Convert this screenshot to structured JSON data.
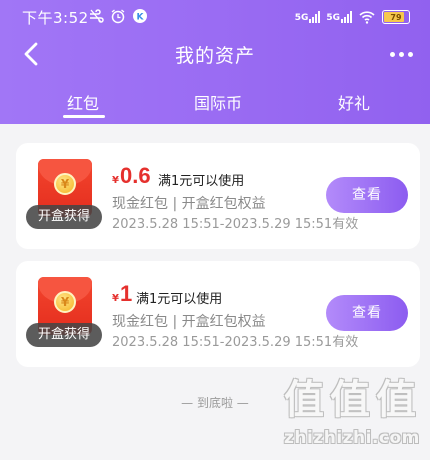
{
  "status_bar": {
    "time": "下午3:52",
    "battery": "79",
    "signal_label": "5G"
  },
  "nav": {
    "title": "我的资产"
  },
  "tabs": [
    {
      "label": "红包",
      "active": true
    },
    {
      "label": "国际币",
      "active": false
    },
    {
      "label": "好礼",
      "active": false
    }
  ],
  "cards": [
    {
      "badge": "开盒获得",
      "coin_symbol": "¥",
      "currency": "¥",
      "amount": "0.6",
      "condition": "满1元可以使用",
      "type_line": "现金红包 | 开盒红包权益",
      "validity": "2023.5.28 15:51-2023.5.29 15:51有效",
      "button": "查看"
    },
    {
      "badge": "开盒获得",
      "coin_symbol": "¥",
      "currency": "¥",
      "amount": "1",
      "condition": "满1元可以使用",
      "type_line": "现金红包 | 开盒红包权益",
      "validity": "2023.5.28 15:51-2023.5.29 15:51有效",
      "button": "查看"
    }
  ],
  "footer_note": "— 到底啦 —",
  "watermark": {
    "chars": [
      "值",
      "值",
      "值"
    ],
    "text": "zhizhizhi.com"
  },
  "colors": {
    "header_gradient_start": "#a176f6",
    "header_gradient_end": "#9161ef",
    "amount_red": "#e5302d",
    "button_gradient_start": "#b38bfa",
    "button_gradient_end": "#8c5cf0",
    "background": "#f4f4f6"
  },
  "icons": {
    "back": "chevron-left-icon",
    "more": "more-dots-icon",
    "coin": "yuan-coin-icon"
  }
}
